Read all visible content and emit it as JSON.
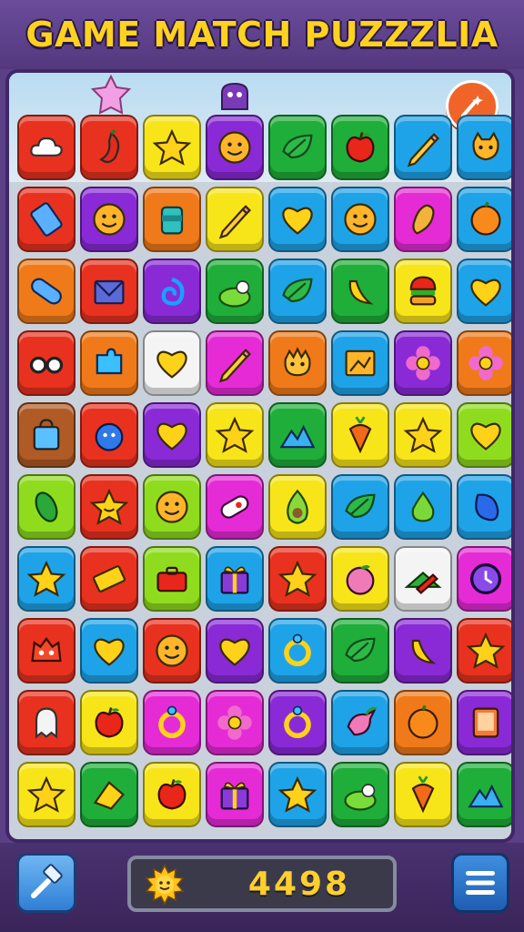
{
  "title": "GAME MATCH PUZZZLIA",
  "score": "4498",
  "colors": {
    "red": "#e8321f",
    "orange": "#f07a1a",
    "yellow": "#f7e51a",
    "purple": "#8a2ad6",
    "green": "#1fae3a",
    "blue": "#1fa3e8",
    "magenta": "#e52bd6",
    "lime": "#8fdc1f",
    "white": "#f4f4f4",
    "brown": "#b05a25",
    "darkred": "#c7261a"
  },
  "tiles": [
    [
      {
        "color": "red",
        "icon": "cloud-icon"
      },
      {
        "color": "red",
        "icon": "chili-icon"
      },
      {
        "color": "yellow",
        "icon": "star-icon"
      },
      {
        "color": "purple",
        "icon": "smiley-face-icon"
      },
      {
        "color": "green",
        "icon": "leaf-icon"
      },
      {
        "color": "green",
        "icon": "apple-icon"
      },
      {
        "color": "blue",
        "icon": "pencil-icon"
      },
      {
        "color": "blue",
        "icon": "cat-face-icon"
      }
    ],
    [
      {
        "color": "red",
        "icon": "phone-icon"
      },
      {
        "color": "purple",
        "icon": "smiley-face-icon"
      },
      {
        "color": "orange",
        "icon": "jar-icon"
      },
      {
        "color": "yellow",
        "icon": "pencil-icon"
      },
      {
        "color": "blue",
        "icon": "heart-icon"
      },
      {
        "color": "blue",
        "icon": "smiley-face-icon"
      },
      {
        "color": "magenta",
        "icon": "bread-icon"
      },
      {
        "color": "blue",
        "icon": "orange-fruit-icon"
      }
    ],
    [
      {
        "color": "orange",
        "icon": "bandage-icon"
      },
      {
        "color": "red",
        "icon": "envelope-icon"
      },
      {
        "color": "purple",
        "icon": "swirl-icon"
      },
      {
        "color": "green",
        "icon": "bush-icon"
      },
      {
        "color": "blue",
        "icon": "leaf-icon"
      },
      {
        "color": "green",
        "icon": "banana-icon"
      },
      {
        "color": "yellow",
        "icon": "burger-icon"
      },
      {
        "color": "blue",
        "icon": "heart-icon"
      }
    ],
    [
      {
        "color": "red",
        "icon": "glasses-icon"
      },
      {
        "color": "orange",
        "icon": "puzzle-icon"
      },
      {
        "color": "white",
        "icon": "heart-icon"
      },
      {
        "color": "magenta",
        "icon": "pencil-icon"
      },
      {
        "color": "orange",
        "icon": "crown-face-icon"
      },
      {
        "color": "blue",
        "icon": "picture-icon"
      },
      {
        "color": "purple",
        "icon": "flower-icon"
      },
      {
        "color": "orange",
        "icon": "flower-icon"
      }
    ],
    [
      {
        "color": "brown",
        "icon": "bag-icon"
      },
      {
        "color": "red",
        "icon": "berry-icon"
      },
      {
        "color": "purple",
        "icon": "heart-icon"
      },
      {
        "color": "yellow",
        "icon": "star-icon"
      },
      {
        "color": "green",
        "icon": "mountain-icon"
      },
      {
        "color": "yellow",
        "icon": "carrot-icon"
      },
      {
        "color": "yellow",
        "icon": "star-icon"
      },
      {
        "color": "lime",
        "icon": "heart-icon"
      }
    ],
    [
      {
        "color": "lime",
        "icon": "pickle-icon"
      },
      {
        "color": "red",
        "icon": "star-face-icon"
      },
      {
        "color": "lime",
        "icon": "smiley-face-icon"
      },
      {
        "color": "magenta",
        "icon": "pill-icon"
      },
      {
        "color": "yellow",
        "icon": "avocado-icon"
      },
      {
        "color": "blue",
        "icon": "leaf-icon"
      },
      {
        "color": "blue",
        "icon": "pear-icon"
      },
      {
        "color": "blue",
        "icon": "bean-icon"
      }
    ],
    [
      {
        "color": "blue",
        "icon": "star-icon"
      },
      {
        "color": "red",
        "icon": "ticket-icon"
      },
      {
        "color": "lime",
        "icon": "briefcase-icon"
      },
      {
        "color": "blue",
        "icon": "gift-icon"
      },
      {
        "color": "red",
        "icon": "star-icon"
      },
      {
        "color": "yellow",
        "icon": "peach-icon"
      },
      {
        "color": "white",
        "icon": "book-icon"
      },
      {
        "color": "magenta",
        "icon": "clock-icon"
      }
    ],
    [
      {
        "color": "red",
        "icon": "monster-face-icon"
      },
      {
        "color": "blue",
        "icon": "heart-icon"
      },
      {
        "color": "red",
        "icon": "smiley-face-icon"
      },
      {
        "color": "purple",
        "icon": "heart-icon"
      },
      {
        "color": "blue",
        "icon": "ring-icon"
      },
      {
        "color": "green",
        "icon": "leaf-icon"
      },
      {
        "color": "purple",
        "icon": "banana-icon"
      },
      {
        "color": "red",
        "icon": "star-icon"
      }
    ],
    [
      {
        "color": "red",
        "icon": "ghost-icon"
      },
      {
        "color": "yellow",
        "icon": "apple-icon"
      },
      {
        "color": "magenta",
        "icon": "ring-icon"
      },
      {
        "color": "magenta",
        "icon": "flower-icon"
      },
      {
        "color": "purple",
        "icon": "ring-icon"
      },
      {
        "color": "blue",
        "icon": "bird-icon"
      },
      {
        "color": "orange",
        "icon": "orange-fruit-icon"
      },
      {
        "color": "purple",
        "icon": "tablet-icon"
      }
    ],
    [
      {
        "color": "yellow",
        "icon": "star-icon"
      },
      {
        "color": "green",
        "icon": "cheese-icon"
      },
      {
        "color": "yellow",
        "icon": "apple-icon"
      },
      {
        "color": "magenta",
        "icon": "gift-icon"
      },
      {
        "color": "blue",
        "icon": "star-icon"
      },
      {
        "color": "green",
        "icon": "bush-icon"
      },
      {
        "color": "yellow",
        "icon": "carrot-icon"
      },
      {
        "color": "green",
        "icon": "mountain-icon"
      }
    ]
  ]
}
